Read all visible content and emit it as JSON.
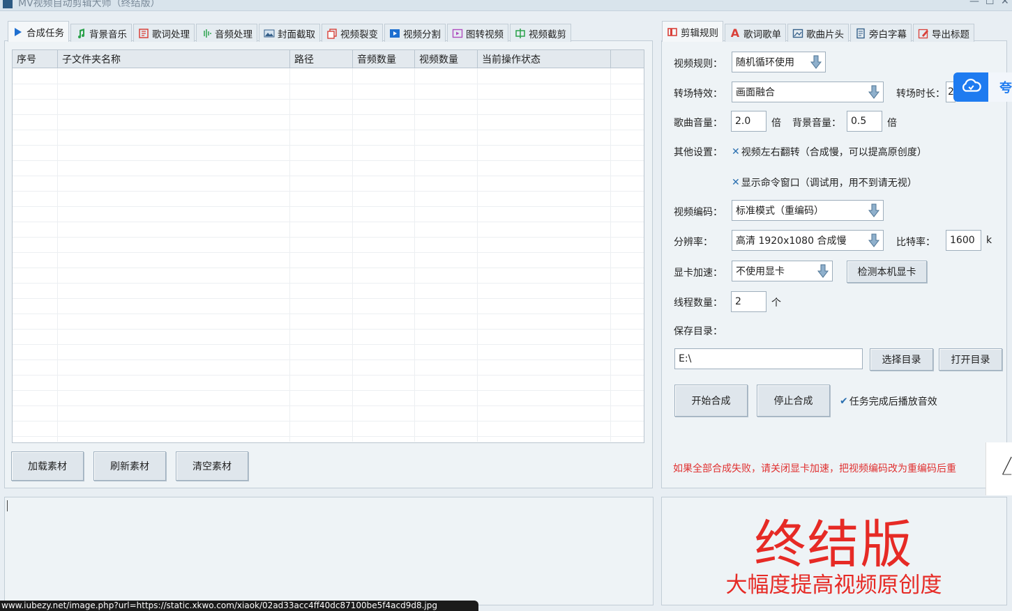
{
  "window": {
    "title": "MV视频自动剪辑大师（终结版）",
    "minimize": "—",
    "maximize": "☐",
    "close": "✕"
  },
  "left_tabs": [
    {
      "label": "合成任务",
      "icon": "play-icon"
    },
    {
      "label": "背景音乐",
      "icon": "music-note-icon"
    },
    {
      "label": "歌词处理",
      "icon": "lyrics-icon"
    },
    {
      "label": "音频处理",
      "icon": "audio-wave-icon"
    },
    {
      "label": "封面截取",
      "icon": "image-icon"
    },
    {
      "label": "视频裂变",
      "icon": "copy-icon"
    },
    {
      "label": "视频分割",
      "icon": "split-icon"
    },
    {
      "label": "图转视频",
      "icon": "image-to-video-icon"
    },
    {
      "label": "视频截剪",
      "icon": "crop-icon"
    }
  ],
  "table": {
    "columns": [
      "序号",
      "子文件夹名称",
      "路径",
      "音频数量",
      "视频数量",
      "当前操作状态",
      ""
    ],
    "rows": []
  },
  "left_buttons": {
    "load": "加载素材",
    "refresh": "刷新素材",
    "clear": "清空素材"
  },
  "right_tabs": [
    {
      "label": "剪辑规则",
      "icon": "film-icon"
    },
    {
      "label": "歌词歌单",
      "icon": "font-a-icon"
    },
    {
      "label": "歌曲片头",
      "icon": "picture-icon"
    },
    {
      "label": "旁白字幕",
      "icon": "document-icon"
    },
    {
      "label": "导出标题",
      "icon": "edit-icon"
    }
  ],
  "settings": {
    "video_rule_label": "视频规则：",
    "video_rule_value": "随机循环使用",
    "transition_label": "转场特效：",
    "transition_value": "画面融合",
    "transition_duration_label": "转场时长：",
    "transition_duration_value": "2",
    "song_volume_label": "歌曲音量：",
    "song_volume_value": "2.0",
    "times_unit": "倍",
    "bg_volume_label": "背景音量：",
    "bg_volume_value": "0.5",
    "other_label": "其他设置：",
    "flip_option": "视频左右翻转（合成慢，可以提高原创度）",
    "console_option": "显示命令窗口（调试用，用不到请无视）",
    "encode_label": "视频编码：",
    "encode_value": "标准模式（重编码）",
    "resolution_label": "分辨率：",
    "resolution_value": "高清 1920x1080 合成慢",
    "bitrate_label": "比特率：",
    "bitrate_value": "1600",
    "bitrate_unit": "k",
    "gpu_label": "显卡加速：",
    "gpu_value": "不使用显卡",
    "detect_gpu": "检测本机显卡",
    "threads_label": "线程数量：",
    "threads_value": "2",
    "threads_unit": "个",
    "save_dir_label": "保存目录：",
    "save_dir_value": "E:\\",
    "choose_dir": "选择目录",
    "open_dir": "打开目录",
    "start": "开始合成",
    "stop": "停止合成",
    "play_sound_option": "任务完成后播放音效",
    "warning": "如果全部合成失败，请关闭显卡加速，把视频编码改为重编码后重"
  },
  "promo": {
    "title": "终结版",
    "subtitle": "大幅度提高视频原创度"
  },
  "overlay": {
    "cloud_side_text": "夸"
  },
  "status_url": "www.iubezy.net/image.php?url=https://static.xkwo.com/xiaok/02ad33acc4ff40dc87100be5f4acd9d8.jpg",
  "colors": {
    "accent": "#1e7bf0",
    "promo_red": "#e62a25",
    "warning_red": "#e03030",
    "check_blue": "#2a6fb0"
  }
}
